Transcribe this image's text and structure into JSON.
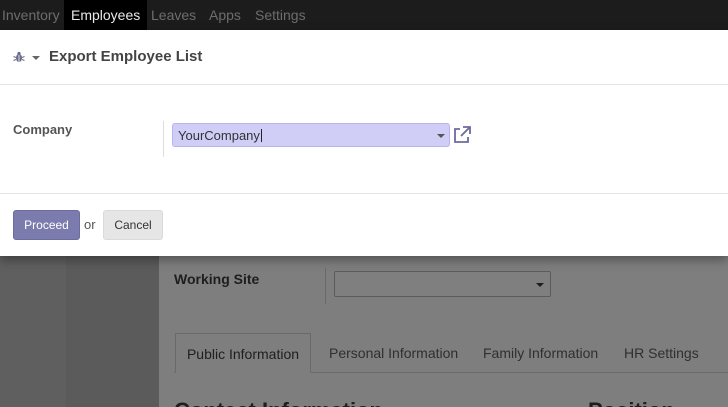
{
  "navbar": {
    "items": [
      {
        "label": "Inventory",
        "active": false
      },
      {
        "label": "Employees",
        "active": true
      },
      {
        "label": "Leaves",
        "active": false
      },
      {
        "label": "Apps",
        "active": false
      },
      {
        "label": "Settings",
        "active": false
      }
    ]
  },
  "modal": {
    "title": "Export Employee List",
    "debug_icon": "bug-icon",
    "fields": {
      "company": {
        "label": "Company",
        "value": "YourCompany",
        "external_icon": "external-link-icon"
      }
    },
    "footer": {
      "proceed_label": "Proceed",
      "or_text": "or",
      "cancel_label": "Cancel"
    }
  },
  "background_form": {
    "working_site_label": "Working Site",
    "working_site_value": "",
    "tabs": [
      {
        "label": "Public Information",
        "active": true
      },
      {
        "label": "Personal Information",
        "active": false
      },
      {
        "label": "Family Information",
        "active": false
      },
      {
        "label": "HR Settings",
        "active": false
      }
    ],
    "section_heading": "Contact Information",
    "section_heading_right": "Position"
  },
  "colors": {
    "primary_button": "#7c7bad",
    "input_highlight": "#d0cdf7",
    "navbar": "#1c1c1c"
  }
}
